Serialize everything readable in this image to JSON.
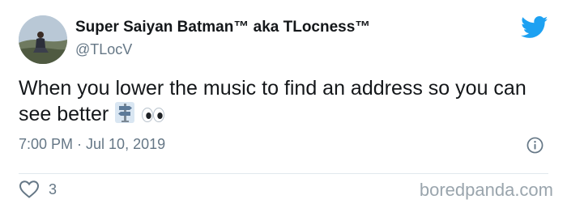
{
  "author": {
    "display_name": "Super Saiyan Batman™ aka TLocness™",
    "handle": "@TLocV",
    "avatar_icon": "profile-photo"
  },
  "tweet": {
    "text": "When you lower the music to find an address so you can see better",
    "emojis": [
      "signpost",
      "eyes"
    ],
    "time": "7:00 PM · Jul 10, 2019"
  },
  "engagement": {
    "likes": "3"
  },
  "watermark": "boredpanda.com",
  "colors": {
    "twitter_blue": "#1da1f2",
    "muted_text": "#657786",
    "body_text": "#14171a"
  },
  "icons": {
    "brand": "twitter-bird-icon",
    "info": "info-icon",
    "like": "heart-icon"
  }
}
